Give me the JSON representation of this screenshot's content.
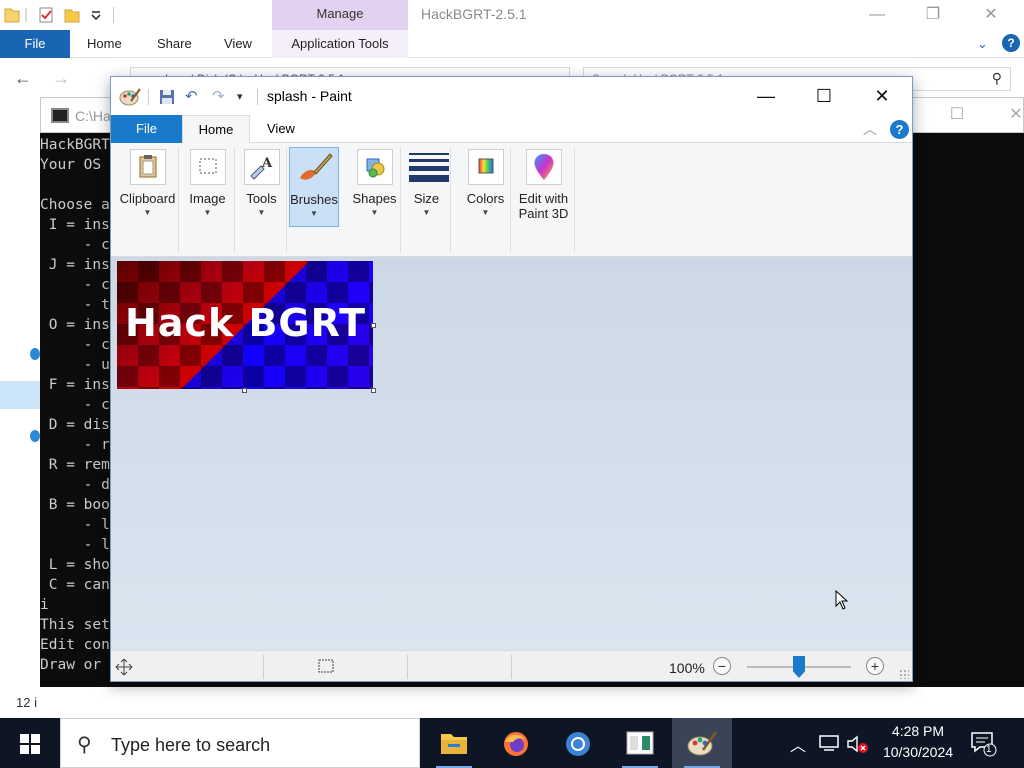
{
  "explorer": {
    "manage_label": "Manage",
    "title": "HackBGRT-2.5.1",
    "tabs": {
      "file": "File",
      "home": "Home",
      "share": "Share",
      "view": "View",
      "app_tools": "Application Tools"
    },
    "path": "« Local Disk (C:) › HackBGRT-2.5.1 ›",
    "search_placeholder": "Search HackBGRT-2.5.1",
    "status": "12 i"
  },
  "console": {
    "title": "C:\\Ha",
    "lines": [
      "HackBGRT",
      "Your OS",
      "",
      "Choose a",
      " I = ins",
      "     - c",
      " J = ins",
      "     - c",
      "     - t",
      " O = ins",
      "     - c",
      "     - u",
      " F = ins",
      "     - c",
      " D = dis",
      "     - r",
      " R = rem",
      "     - d",
      " B = boo",
      "     - l",
      "     - l",
      " L = sho",
      " C = can",
      "i",
      "This set",
      "Edit con",
      "Draw or"
    ]
  },
  "paint": {
    "title": "splash - Paint",
    "tabs": {
      "file": "File",
      "home": "Home",
      "view": "View"
    },
    "help_label": "?",
    "ribbon": [
      {
        "label": "Clipboard",
        "icon": "clipboard-icon"
      },
      {
        "label": "Image",
        "icon": "select-icon"
      },
      {
        "label": "Tools",
        "icon": "tools-icon"
      },
      {
        "label": "Brushes",
        "icon": "brush-icon"
      },
      {
        "label": "Shapes",
        "icon": "shapes-icon"
      },
      {
        "label": "Size",
        "icon": "size-icon"
      },
      {
        "label": "Colors",
        "icon": "colors-icon"
      },
      {
        "label": "Edit with\nPaint 3D",
        "icon": "paint3d-icon"
      }
    ],
    "image_text": "Hack BGRT",
    "zoom": "100%"
  },
  "taskbar": {
    "search_placeholder": "Type here to search",
    "time": "4:28 PM",
    "date": "10/30/2024",
    "notification_count": "1"
  }
}
